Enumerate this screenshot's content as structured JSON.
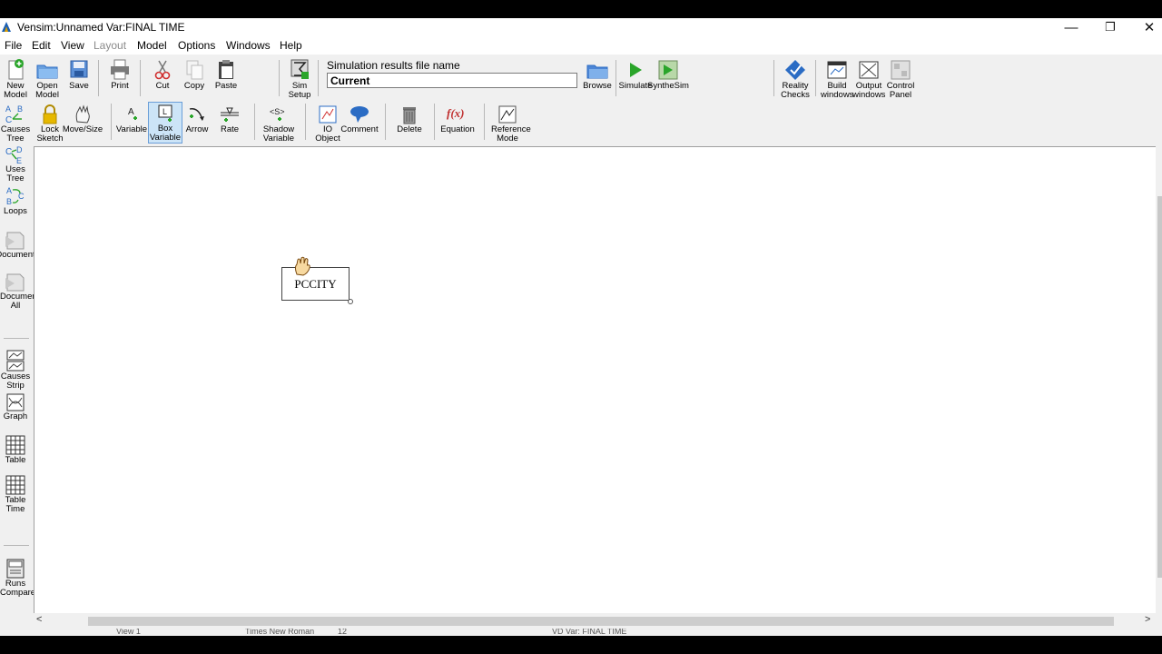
{
  "window": {
    "title": "Vensim:Unnamed Var:FINAL TIME",
    "controls": {
      "minimize": "—",
      "restore": "❐",
      "close": "✕"
    }
  },
  "menu": [
    "File",
    "Edit",
    "View",
    "Layout",
    "Model",
    "Options",
    "Windows",
    "Help"
  ],
  "toolbar_top": {
    "new_model": "New Model",
    "open_model": "Open Model",
    "save": "Save",
    "print": "Print",
    "cut": "Cut",
    "copy": "Copy",
    "paste": "Paste",
    "sim_setup": "Sim Setup",
    "sim_results_label": "Simulation results file name",
    "sim_results_value": "Current",
    "browse": "Browse",
    "simulate": "Simulate",
    "synthesim": "SyntheSim",
    "reality_checks": "Reality Checks",
    "build_windows": "Build windows",
    "output_windows": "Output windows",
    "control_panel": "Control Panel"
  },
  "toolbar_sketch": {
    "causes_tree": "Causes Tree",
    "lock_sketch": "Lock Sketch",
    "move_size": "Move/Size",
    "variable": "Variable",
    "box_variable": "Box Variable",
    "arrow": "Arrow",
    "rate": "Rate",
    "shadow_variable": "Shadow Variable",
    "io_object": "IO Object",
    "comment": "Comment",
    "delete": "Delete",
    "equation": "Equation",
    "reference_mode": "Reference Mode"
  },
  "left_toolbar": {
    "uses_tree": "Uses Tree",
    "loops": "Loops",
    "document": "Document",
    "document_all": "Document All",
    "causes_strip": "Causes Strip",
    "graph": "Graph",
    "table": "Table",
    "table_time": "Table Time",
    "runs_compare": "Runs Compare"
  },
  "canvas": {
    "variable_name": "PCCITY"
  },
  "status": {
    "view": "View 1",
    "font": "Times New Roman",
    "size": "12",
    "var": "VD Var: FINAL TIME"
  },
  "colors": {
    "accent": "#cce4f7",
    "icon_blue": "#2b6cc4",
    "icon_green": "#2aa52a"
  }
}
